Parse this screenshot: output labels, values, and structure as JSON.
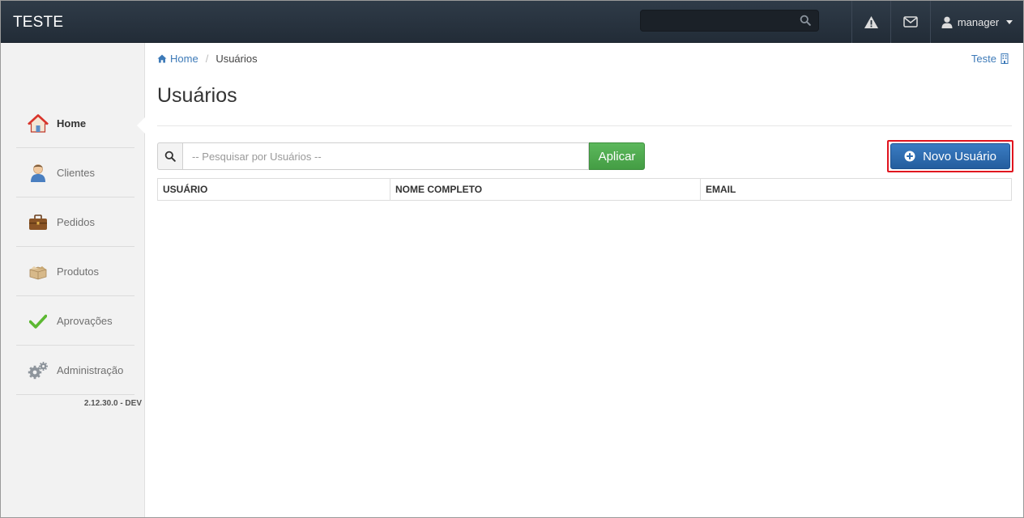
{
  "topbar": {
    "brand": "TESTE",
    "search_placeholder": "",
    "user_name": "manager"
  },
  "sidebar": {
    "items": [
      {
        "label": "Home",
        "icon": "house-icon",
        "active": true
      },
      {
        "label": "Clientes",
        "icon": "user-icon"
      },
      {
        "label": "Pedidos",
        "icon": "briefcase-icon"
      },
      {
        "label": "Produtos",
        "icon": "box-icon"
      },
      {
        "label": "Aprovações",
        "icon": "checkmark-icon"
      },
      {
        "label": "Administração",
        "icon": "gears-icon"
      }
    ],
    "version": "2.12.30.0 - DEV"
  },
  "breadcrumb": {
    "home": "Home",
    "separator": "/",
    "current": "Usuários"
  },
  "org_link": "Teste",
  "page_title": "Usuários",
  "search": {
    "placeholder": "-- Pesquisar por Usuários --",
    "value": "",
    "apply_label": "Aplicar"
  },
  "new_user_button": "Novo Usuário",
  "table": {
    "columns": [
      "USUÁRIO",
      "NOME COMPLETO",
      "EMAIL"
    ],
    "rows": []
  },
  "colors": {
    "topbar": "#26313c",
    "sidebar": "#f2f2f2",
    "link": "#3d7ab8",
    "apply_button": "#4cae4c",
    "primary_button": "#2d6cb0",
    "highlight_border": "#e0141e"
  }
}
